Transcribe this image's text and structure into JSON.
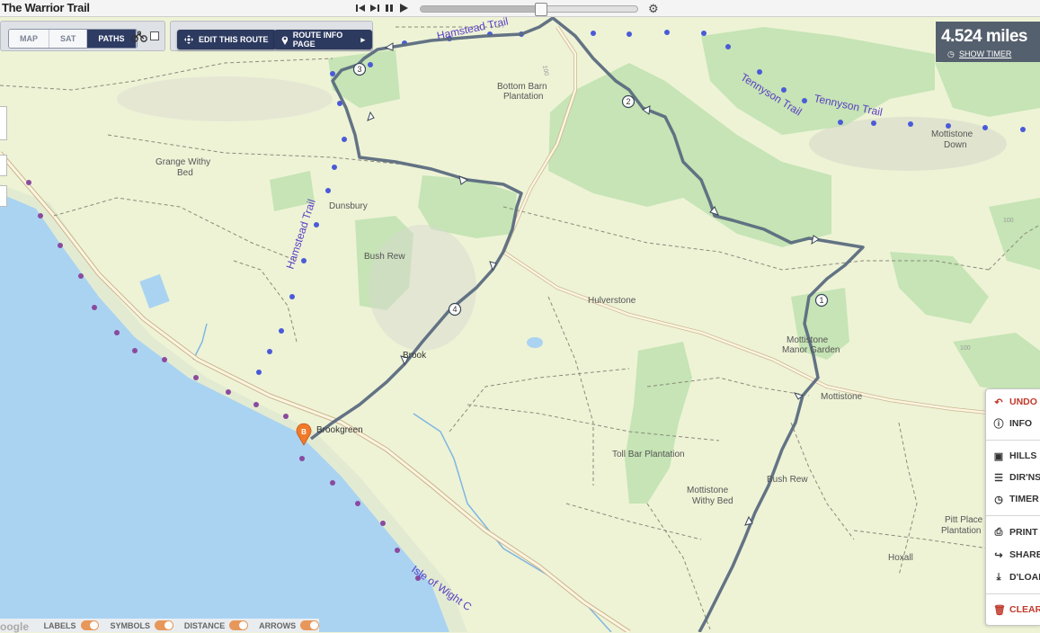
{
  "app_title": "The Warrior Trail",
  "player": {
    "progress_fraction": 0.55
  },
  "map_type": {
    "options": [
      "MAP",
      "SAT",
      "PATHS"
    ],
    "selected": "PATHS"
  },
  "toolbar": {
    "edit_label": "EDIT THIS ROUTE",
    "info_label": "ROUTE INFO PAGE"
  },
  "distance": {
    "value": "4.524 miles",
    "timer_link": "SHOW TIMER"
  },
  "right_menu": {
    "undo": "UNDO",
    "info": "INFO",
    "hills": "HILLS",
    "directions": "DIR'NS",
    "timer": "TIMER",
    "print": "PRINT",
    "share": "SHARE",
    "download": "D'LOAD",
    "clear": "CLEAR"
  },
  "bottom_toggles": [
    "LABELS",
    "SYMBOLS",
    "DISTANCE",
    "ARROWS"
  ],
  "google_text": "oogle",
  "map_labels": {
    "hamstead_trail_top": "Hamstead Trail",
    "hamstead_trail_side": "Hamstead Trail",
    "tennyson_trail_1": "Tennyson Trail",
    "tennyson_trail_2": "Tennyson Trail",
    "bottom_barn_1": "Bottom Barn",
    "bottom_barn_2": "Plantation",
    "grange_withy_1": "Grange Withy",
    "grange_withy_2": "Bed",
    "dunsbury": "Dunsbury",
    "bush_rew": "Bush Rew",
    "hulverstone": "Hulverstone",
    "mottistone_manor_1": "Mottistone",
    "mottistone_manor_2": "Manor Garden",
    "mottistone": "Mottistone",
    "mottistone_down_1": "Mottistone",
    "mottistone_down_2": "Down",
    "brook": "Brook",
    "brookgreen": "Brookgreen",
    "toll_bar": "Toll Bar Plantation",
    "mottistone_withy_1": "Mottistone",
    "mottistone_withy_2": "Withy Bed",
    "bush_rew_2": "Bush Rew",
    "pitt_place_1": "Pitt Place",
    "pitt_place_2": "Plantation",
    "hoxall": "Hoxall",
    "isle_of_wight_coast": "Isle of Wight C",
    "contour_1": "100",
    "contour_2": "100",
    "contour_3": "100"
  },
  "route_markers": [
    "1",
    "2",
    "3",
    "4"
  ],
  "start_marker": "B",
  "colors": {
    "sea": "#aad3f1",
    "land": "#eef3d6",
    "woods": "#c5e3b6",
    "route": "#5b6b80",
    "path_dots_blue": "#4a5ad8",
    "path_dots_purple": "#8a4a9e",
    "panel_dark": "#2d3a60"
  }
}
